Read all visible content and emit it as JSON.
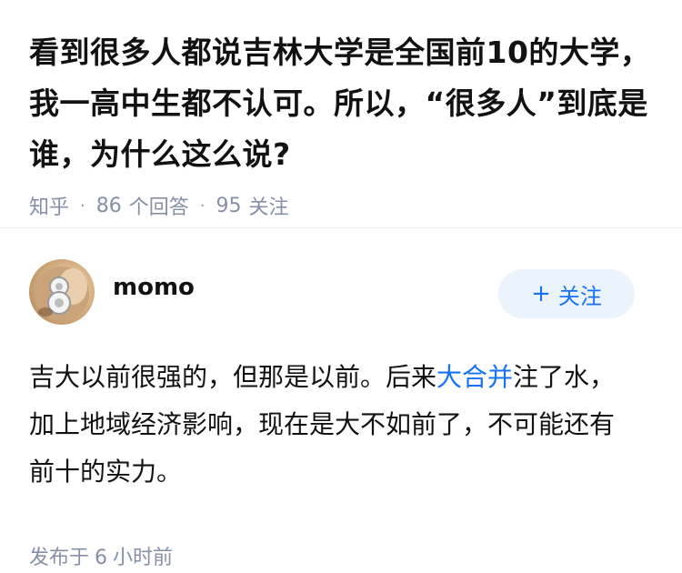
{
  "question": {
    "title": "看到很多人都说吉林大学是全国前10的大学，我一高中生都不认可。所以，“很多人”到底是谁，为什么这么说?",
    "source": "知乎",
    "answer_count": "86",
    "answer_label": "个回答",
    "follower_count": "95",
    "follower_label": "关注"
  },
  "answer": {
    "author_name": "momo",
    "avatar_icon": "avatar-icon",
    "follow_plus": "+",
    "follow_label": "关注",
    "content_part1": "吉大以前很强的，但那是以前。后来",
    "content_link": "大合并",
    "content_part2": "注了水，加上地域经济影响，现在是大不如前了，不可能还有前十的实力。",
    "published_prefix": "发布于",
    "published_num": "6",
    "published_suffix": "小时前"
  },
  "colors": {
    "accent": "#1772f6",
    "meta_gray": "#8590a6",
    "follow_bg": "#ebf3fd"
  }
}
